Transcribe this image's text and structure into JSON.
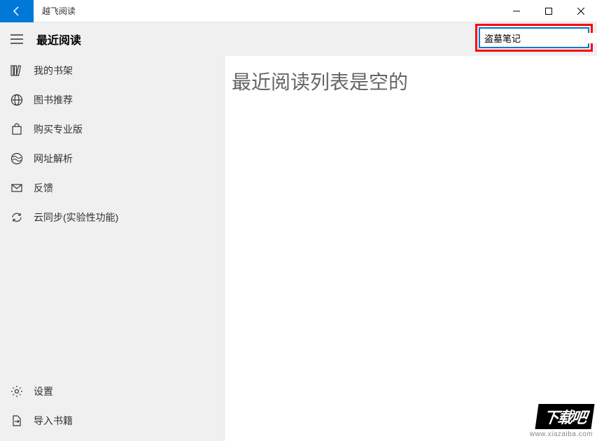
{
  "titlebar": {
    "app_title": "越飞阅读"
  },
  "header": {
    "page_title": "最近阅读"
  },
  "search": {
    "value": "盗墓笔记"
  },
  "sidebar": {
    "items": [
      {
        "icon": "books-icon",
        "label": "我的书架"
      },
      {
        "icon": "globe-icon",
        "label": "图书推荐"
      },
      {
        "icon": "bag-icon",
        "label": "购买专业版"
      },
      {
        "icon": "world-icon",
        "label": "网址解析"
      },
      {
        "icon": "mail-icon",
        "label": "反馈"
      },
      {
        "icon": "sync-icon",
        "label": "云同步(实验性功能)"
      }
    ],
    "bottom": [
      {
        "icon": "gear-icon",
        "label": "设置"
      },
      {
        "icon": "import-icon",
        "label": "导入书籍"
      }
    ]
  },
  "main": {
    "empty_message": "最近阅读列表是空的"
  },
  "watermark": {
    "logo": "下载吧",
    "url": "www.xiazaiba.com"
  }
}
